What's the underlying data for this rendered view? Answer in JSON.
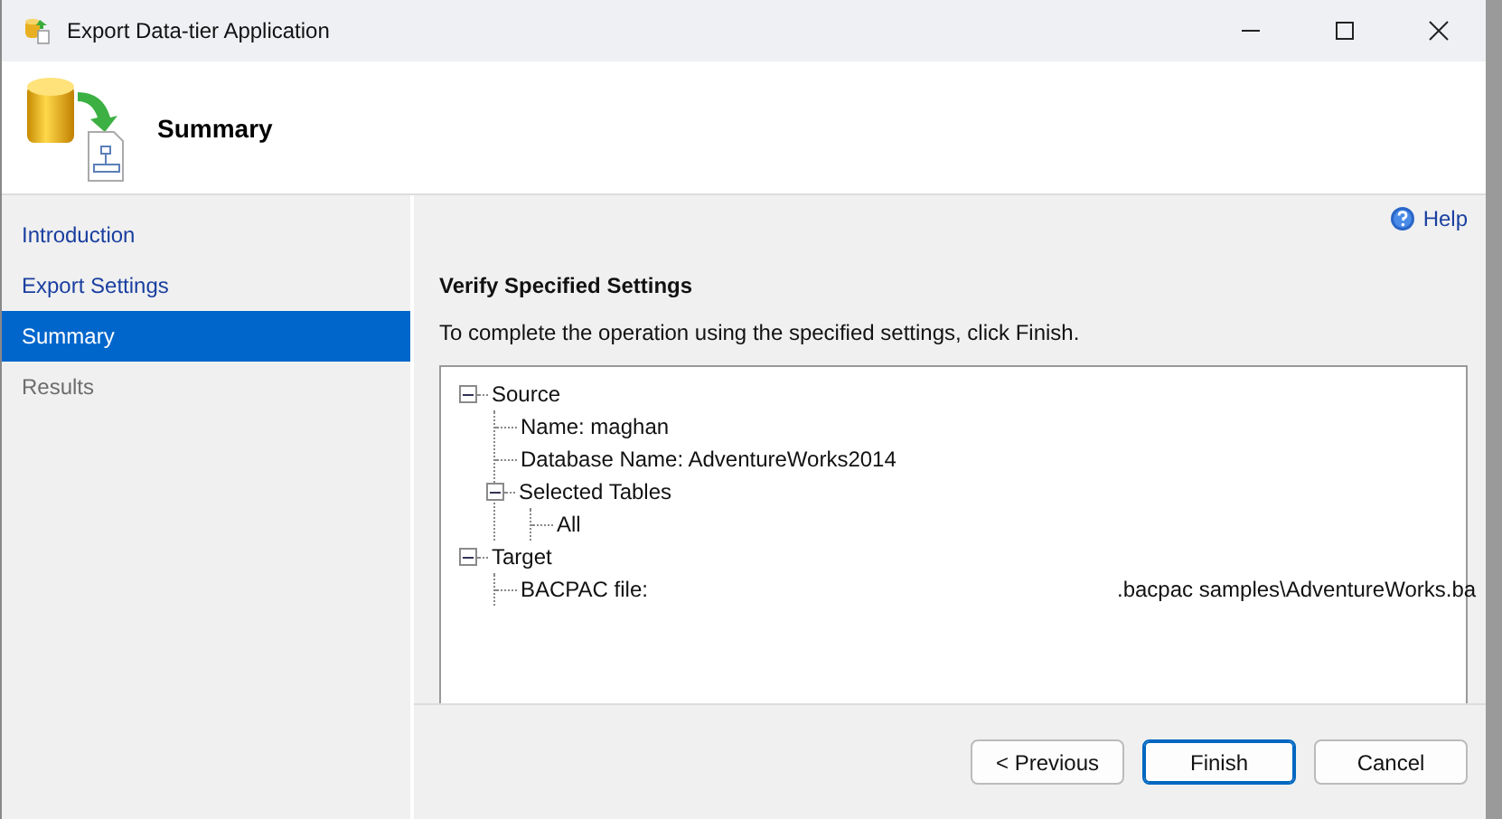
{
  "window": {
    "title": "Export Data-tier Application"
  },
  "header": {
    "title": "Summary"
  },
  "sidebar": {
    "items": [
      {
        "label": "Introduction",
        "selected": false,
        "disabled": false
      },
      {
        "label": "Export Settings",
        "selected": false,
        "disabled": false
      },
      {
        "label": "Summary",
        "selected": true,
        "disabled": false
      },
      {
        "label": "Results",
        "selected": false,
        "disabled": true
      }
    ]
  },
  "help": {
    "label": "Help"
  },
  "section_title": "Verify Specified Settings",
  "instruction": "To complete the operation using the specified settings, click Finish.",
  "tree": [
    {
      "label": "Source",
      "expanded": true,
      "children": [
        {
          "label": "Name: maghan"
        },
        {
          "label": "Database Name: AdventureWorks2014"
        },
        {
          "label": "Selected Tables",
          "expanded": true,
          "children": [
            {
              "label": "All"
            }
          ]
        }
      ]
    },
    {
      "label": "Target",
      "expanded": true,
      "children": [
        {
          "label": "BACPAC file:",
          "value": ".bacpac samples\\AdventureWorks.ba"
        }
      ]
    }
  ],
  "buttons": [
    {
      "label": "< Previous",
      "kind": "normal"
    },
    {
      "label": "Finish",
      "kind": "default"
    },
    {
      "label": "Cancel",
      "kind": "normal"
    }
  ]
}
